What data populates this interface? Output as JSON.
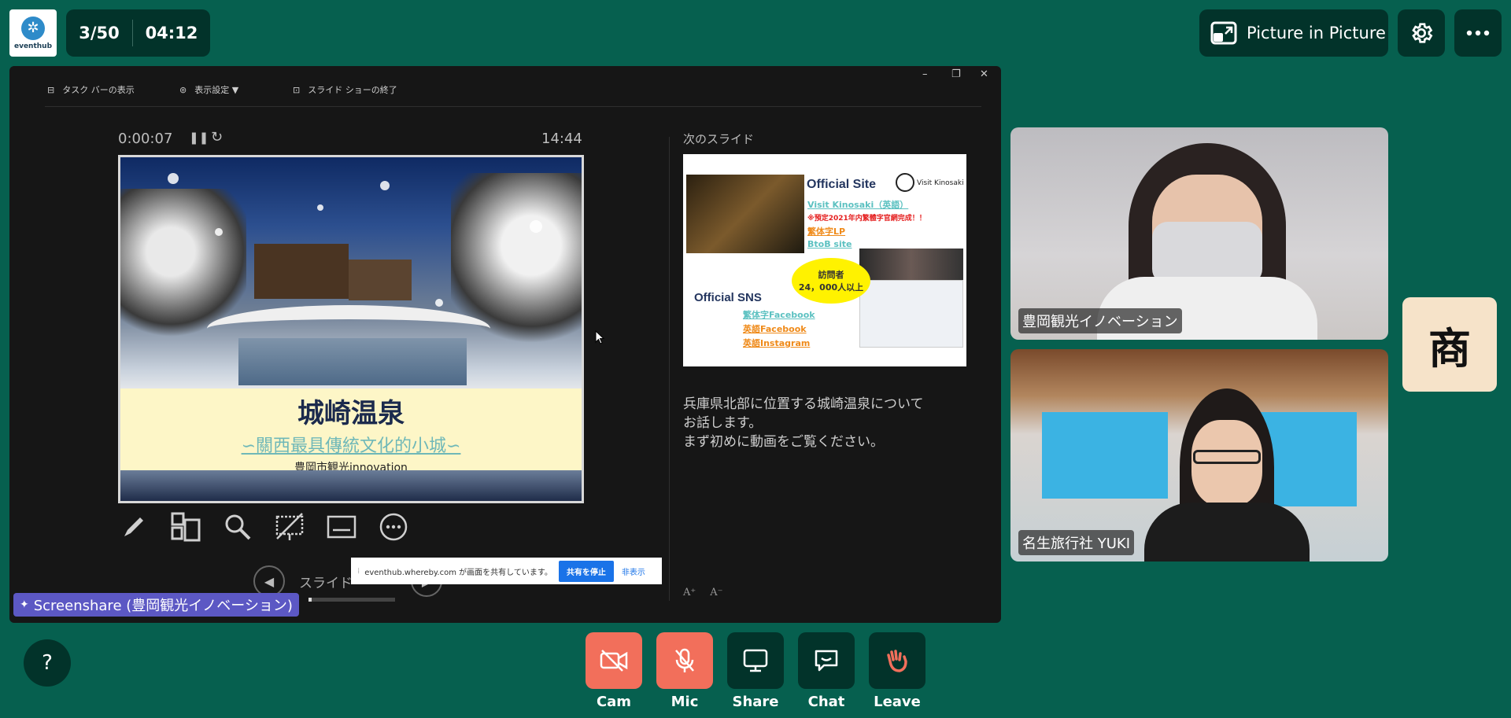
{
  "logo": {
    "text": "eventhub"
  },
  "counter": {
    "slide": "3/50",
    "time": "04:12"
  },
  "top_right": {
    "pip_label": "Picture in Picture"
  },
  "ppt_toolbar": {
    "taskbar": "タスク バーの表示",
    "display_settings": "表示設定 ▼",
    "end_show": "スライド ショーの終了"
  },
  "presenter": {
    "elapsed": "0:00:07",
    "clock": "14:44",
    "next_slide_label": "次のスライド",
    "slide_nav_label": "スライド",
    "notes": [
      "兵庫県北部に位置する城崎温泉について",
      "お話します。",
      "まず初めに動画をご覧ください。"
    ],
    "progress": 0.04
  },
  "current_slide": {
    "title": "城崎温泉",
    "subtitle": "∽關西最具傳統文化的小城∽",
    "credit": "豊岡市観光innovation"
  },
  "next_slide": {
    "official_site": "Official Site",
    "visit_kinosaki_logo": "Visit Kinosaki",
    "link1": "Visit Kinosaki（英語）",
    "note_red": "※預定2021年内繁體字官網完成！！",
    "link2": "繁体字LP",
    "link3": "BtoB site",
    "bubble_line1": "訪問者",
    "bubble_line2": "24，000人以上",
    "official_sns": "Official SNS",
    "sns1": "繁体字Facebook",
    "sns2": "英語Facebook",
    "sns3": "英語Instagram"
  },
  "share_bar": {
    "message": "eventhub.whereby.com が画面を共有しています。",
    "stop": "共有を停止",
    "hide": "非表示"
  },
  "screenshare_label": "Screenshare (豊岡観光イノベーション)",
  "participants": [
    {
      "name": "豊岡観光イノベーション"
    },
    {
      "name": "名生旅行社 YUKI"
    }
  ],
  "avatar_initial": "商",
  "help_label": "?",
  "controls": {
    "cam": "Cam",
    "mic": "Mic",
    "share": "Share",
    "chat": "Chat",
    "leave": "Leave"
  },
  "colors": {
    "background": "#06604f",
    "panel": "#02332a",
    "danger": "#f26f5b",
    "screenshare_badge": "#5c58c4"
  }
}
